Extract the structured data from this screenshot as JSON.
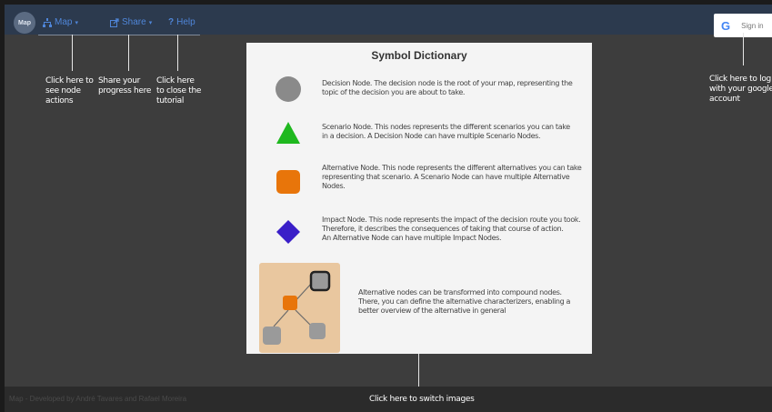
{
  "navbar": {
    "logo_text": "Map",
    "map_label": "Map",
    "share_label": "Share",
    "help_label": "Help",
    "signin_g": "G",
    "signin_label": "Sign in"
  },
  "tips": {
    "node_actions": [
      "Click here to",
      "see node",
      "actions"
    ],
    "share": [
      "Share your",
      "progress here"
    ],
    "help": [
      "Click here",
      "to close the",
      "tutorial"
    ],
    "signin": [
      "Click here to log in",
      "with your google",
      "account"
    ],
    "switch_images": "Click here to switch images"
  },
  "dictionary": {
    "title": "Symbol Dictionary",
    "decision": [
      "Decision Node. The decision node is the root of your map, representing the",
      "topic of the decision you are about to take."
    ],
    "scenario": [
      "Scenario Node. This nodes represents the different scenarios you can take",
      "in a decision. A Decision Node can have multiple Scenario Nodes."
    ],
    "alternative": [
      "Alternative Node. This node represents the different alternatives you can take",
      "representing  that scenario. A Scenario Node can have multiple Alternative",
      "Nodes."
    ],
    "impact": [
      "Impact Node. This node represents the impact of the decision route you took.",
      "Therefore, it describes the consequences of taking that course of action.",
      "An Alternative Node  can have multiple Impact Nodes."
    ],
    "compound": [
      "Alternative nodes can be transformed into compound nodes.",
      "There, you can define the alternative characterizers, enabling a",
      "better overview of the alternative in general"
    ]
  },
  "footer": {
    "credit": "Map - Developed by André Tavares and Rafael Moreira"
  },
  "colors": {
    "decision": "#8a8a8a",
    "scenario": "#1fb81f",
    "alternative": "#e8750a",
    "impact": "#3a1fc8",
    "compound_bg": "#e9c79f",
    "nav_link": "#4f86d9"
  },
  "icons": {
    "map": "sitemap-icon",
    "share": "share-icon",
    "help": "question-icon",
    "google": "google-icon"
  }
}
